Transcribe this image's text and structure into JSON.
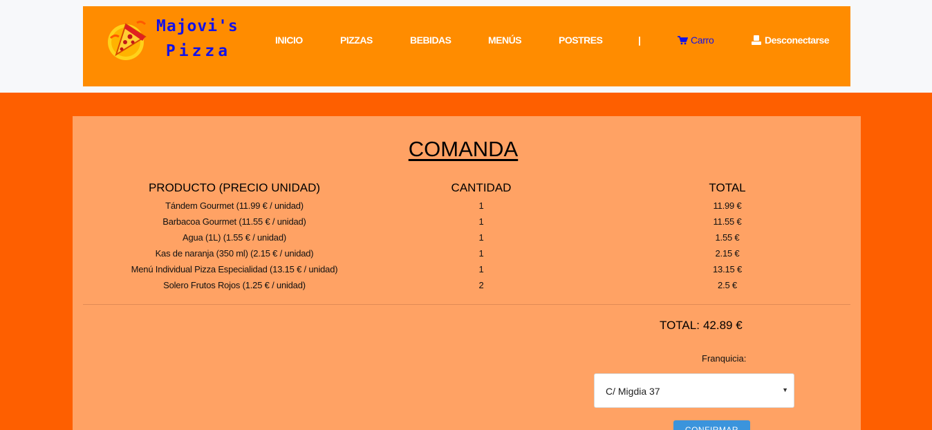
{
  "brand": {
    "line1": "Majovi's",
    "line2": "Pizza",
    "logo_icon": "pizza-slice-logo",
    "color": "#1212e8"
  },
  "nav": {
    "items": [
      {
        "label": "INICIO"
      },
      {
        "label": "PIZZAS"
      },
      {
        "label": "BEBIDAS"
      },
      {
        "label": "MENÚS"
      },
      {
        "label": "POSTRES"
      }
    ],
    "separator": "|",
    "cart": {
      "label": "Carro",
      "icon": "shopping-cart-icon"
    },
    "logout": {
      "label": "Desconectarse",
      "icon": "user-icon"
    }
  },
  "order": {
    "title": "COMANDA",
    "headers": {
      "product": "PRODUCTO (PRECIO UNIDAD)",
      "quantity": "CANTIDAD",
      "total": "TOTAL"
    },
    "rows": [
      {
        "product": "Tándem Gourmet (11.99 € / unidad)",
        "quantity": "1",
        "total": "11.99 €"
      },
      {
        "product": "Barbacoa Gourmet (11.55 € / unidad)",
        "quantity": "1",
        "total": "11.55 €"
      },
      {
        "product": "Agua (1L) (1.55 € / unidad)",
        "quantity": "1",
        "total": "1.55 €"
      },
      {
        "product": "Kas de naranja (350 ml) (2.15 € / unidad)",
        "quantity": "1",
        "total": "2.15 €"
      },
      {
        "product": "Menú Individual Pizza Especialidad (13.15 € / unidad)",
        "quantity": "1",
        "total": "13.15 €"
      },
      {
        "product": "Solero Frutos Rojos (1.25 € / unidad)",
        "quantity": "2",
        "total": "2.5 €"
      }
    ],
    "grand_total_label": "TOTAL:",
    "grand_total_value": "42.89 €"
  },
  "franchise": {
    "label": "Franquicia:",
    "selected": "C/ Migdia 37"
  },
  "confirm_label": "CONFIRMAR",
  "colors": {
    "page_background": "#fe5f00",
    "navbar": "#ff8c00",
    "panel": "#ffa264",
    "confirm_button": "#3b94dc"
  }
}
